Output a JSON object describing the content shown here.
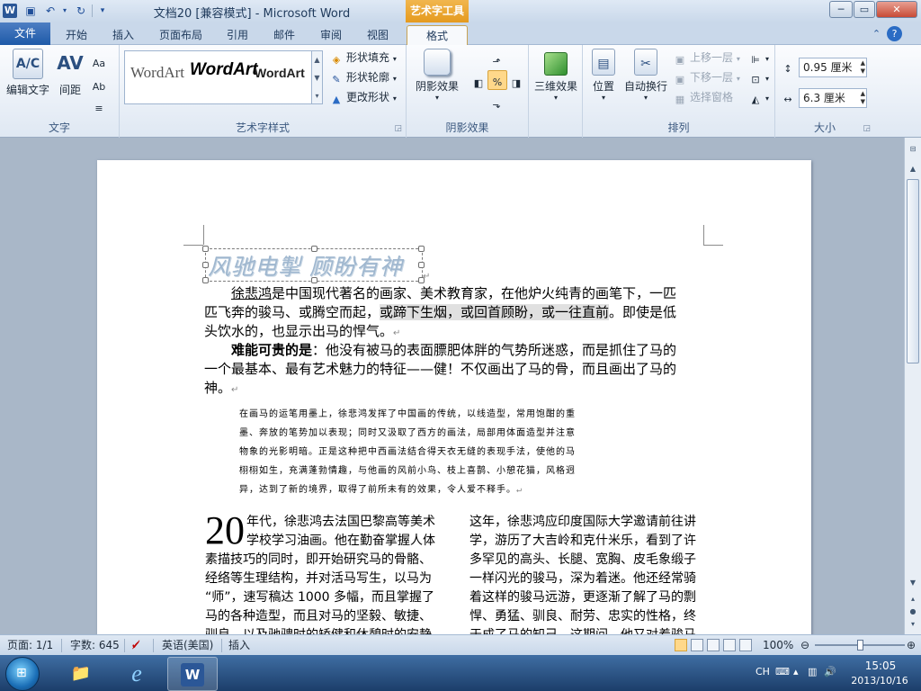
{
  "window": {
    "title": "文档20 [兼容模式] - Microsoft Word",
    "context_tools": "艺术字工具",
    "minimize": "─",
    "restore": "▭",
    "close": "✕"
  },
  "quick_access": {
    "logo": "W",
    "save_icon": "save-icon",
    "undo_icon": "undo-icon",
    "redo_icon": "redo-icon"
  },
  "tabs": [
    "文件",
    "开始",
    "插入",
    "页面布局",
    "引用",
    "邮件",
    "审阅",
    "视图",
    "格式"
  ],
  "ribbon": {
    "text_group": {
      "label": "文字",
      "edit_text": "编辑文字",
      "spacing": "间距",
      "spacing_glyph": "AV",
      "edit_glyph": "A/C"
    },
    "wordart_styles": {
      "label": "艺术字样式",
      "gallery": [
        "WordArt",
        "WordArt",
        "WordArt"
      ],
      "shape_fill": "形状填充",
      "shape_outline": "形状轮廓",
      "change_shape": "更改形状"
    },
    "shadow_group": {
      "label": "阴影效果",
      "shadow_effect": "阴影效果"
    },
    "three_d_group": {
      "label": "",
      "three_d_effect": "三维效果"
    },
    "arrange_group": {
      "label": "排列",
      "position": "位置",
      "wrap_text": "自动换行",
      "bring_forward": "上移一层",
      "send_backward": "下移一层",
      "selection_pane": "选择窗格"
    },
    "size_group": {
      "label": "大小",
      "height": "0.95 厘米",
      "width": "6.3 厘米"
    }
  },
  "document": {
    "wordart": "风驰电掣 顾盼有神",
    "para1_lines": [
      [
        "徐悲鸿",
        "是中国现代著名的画家、美术教育家，在他炉火纯青的画笔下，一匹"
      ],
      [
        "匹飞奔的骏马、或腾空而起，",
        "或蹄下生烟，或回首顾盼，或一往直前",
        "。即使是低"
      ],
      [
        "头饮水的，也显示出马的悍气。"
      ]
    ],
    "para2_bold": "难能可贵的是",
    "para2_lines": [
      "：他没有被马的表面膘肥体胖的气势所迷惑，而是抓住了马的",
      "一个最基本、最有艺术魅力的特征——健！不仅画出了马的骨，而且画出了马的",
      "神。"
    ],
    "quote_lines": [
      "在画马的运笔用墨上，徐悲鸿发挥了中国画的传统，以线造型，常用饱酣的重",
      "墨、奔放的笔势加以表现；同时又汲取了西方的画法，局部用体面造型并注意",
      "物象的光影明暗。正是这种把中西画法结合得天衣无缝的表现手法，使他的马",
      "栩栩如生，充满蓬勃情趣，与他画的风前小鸟、枝上喜鹊、小憩花猫，风格迥",
      "异，达到了新的境界，取得了前所未有的效果，令人爱不释手。"
    ],
    "dropcap": "20",
    "col1_lines": [
      "年代，徐悲鸿去法国巴黎高等美术",
      "学校学习油画。他在勤奋掌握人体",
      "素描技巧的同时，即开始研究马的骨骼、",
      "经络等生理结构，并对活马写生，以马为",
      "“师”，速写稿达 1000 多幅，而且掌握了",
      "马的各种造型，而且对马的坚毅、敏捷、",
      "驯良，以及驰骋时的矫健和休憩时的安静"
    ],
    "col2_lines": [
      "这年，徐悲鸿应印度国际大学邀请前往讲",
      "学，游历了大吉岭和克什米乐，看到了许",
      "多罕见的高头、长腿、宽胸、皮毛象缎子",
      "一样闪光的骏马，深为着迷。他还经常骑",
      "着这样的骏马远游，更逐渐了解了马的剽",
      "悍、勇猛、驯良、耐劳、忠实的性格，终",
      "于成了马的知己。这期间，他又对着骏马"
    ],
    "para_mark": "↵"
  },
  "statusbar": {
    "page": "页面: 1/1",
    "words": "字数: 645",
    "language": "英语(美国)",
    "mode": "插入",
    "zoom": "100%",
    "zoom_level": 0.5
  },
  "taskbar": {
    "ime": "CH",
    "time": "15:05",
    "date": "2013/10/16"
  },
  "colors": {
    "accent": "#2b5797",
    "context_tab": "#e59a1e",
    "wordart": "#9fb7cf"
  }
}
